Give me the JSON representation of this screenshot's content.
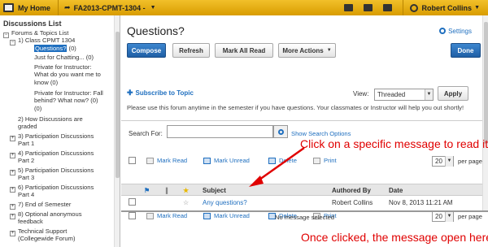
{
  "topbar": {
    "home_label": "My Home",
    "course_label": "FA2013-CPMT-1304 -",
    "user_name": "Robert Collins"
  },
  "sidebar": {
    "title": "Discussions List",
    "items": [
      {
        "label": "Forums & Topics List",
        "toggle": "−"
      },
      {
        "label": "1) Class CPMT 1304",
        "toggle": "−"
      },
      {
        "label": "Questions?",
        "count": "(0)"
      },
      {
        "label": "Just for Chatting...",
        "count": "(0)"
      },
      {
        "label": "Private for Instructor:",
        "cont": "What do you want me to",
        "cont2": "know (0)",
        "count": "(0)"
      },
      {
        "label": "Private for Instructor: Fall",
        "cont": "behind? What now?",
        "count": "(0)",
        "count2": "(0)"
      },
      {
        "label": "2) How Discussions are",
        "cont": "graded"
      },
      {
        "label": "3) Participation Discussions",
        "cont": "Part 1",
        "toggle": "+"
      },
      {
        "label": "4) Participation Discussions",
        "cont": "Part 2",
        "toggle": "+"
      },
      {
        "label": "5) Participation Discussions",
        "cont": "Part 3",
        "toggle": "+"
      },
      {
        "label": "6) Participation Discussions",
        "cont": "Part 4",
        "toggle": "+"
      },
      {
        "label": "7) End of Semester",
        "toggle": "+"
      },
      {
        "label": "8) Optional anonymous",
        "cont": "feedback",
        "toggle": "+"
      },
      {
        "label": "Technical Support",
        "cont": "(Collegewide Forum)",
        "toggle": "+"
      }
    ]
  },
  "main": {
    "heading": "Questions?",
    "settings": "Settings",
    "buttons": {
      "compose": "Compose",
      "refresh": "Refresh",
      "mark_all_read": "Mark All Read",
      "more_actions": "More Actions",
      "done": "Done",
      "apply": "Apply"
    },
    "subscribe": "Subscribe to Topic",
    "view_label": "View:",
    "view_value": "Threaded",
    "description": "Please use this forum anytime in the semester if you have questions. Your classmates or Instructor will help you out shortly!",
    "search_label": "Search For:",
    "search_value": "",
    "show_search": "Show Search Options",
    "toolbar": {
      "mark_read": "Mark Read",
      "mark_unread": "Mark Unread",
      "delete": "Delete",
      "print": "Print",
      "per_page_value": "20",
      "per_page": "per page"
    },
    "table": {
      "headers": {
        "subject": "Subject",
        "authored_by": "Authored By",
        "date": "Date"
      },
      "rows": [
        {
          "subject": "Any questions?",
          "author": "Robert Collins",
          "date": "Nov 8, 2013 11:21 AM"
        }
      ]
    },
    "no_message": "No message selected"
  },
  "annotations": {
    "click_note": "Click on a specific message to read it",
    "open_note": "Once clicked, the message open here"
  },
  "colors": {
    "accent": "#1f6fbf",
    "topbar": "#e0a800",
    "annotation": "#e00000"
  }
}
